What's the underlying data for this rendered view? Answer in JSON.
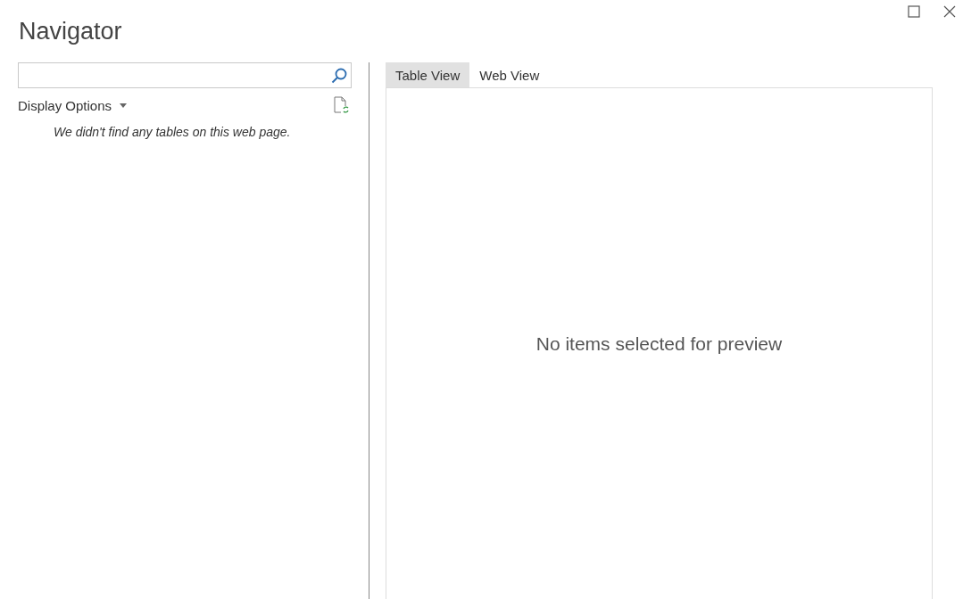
{
  "window": {
    "title": "Navigator"
  },
  "display_options": {
    "label": "Display Options"
  },
  "message": "We didn't find any tables on this web page.",
  "tabs": [
    {
      "label": "Table View",
      "selected": true
    },
    {
      "label": "Web View",
      "selected": false
    }
  ],
  "preview": {
    "message": "No items selected for preview"
  }
}
